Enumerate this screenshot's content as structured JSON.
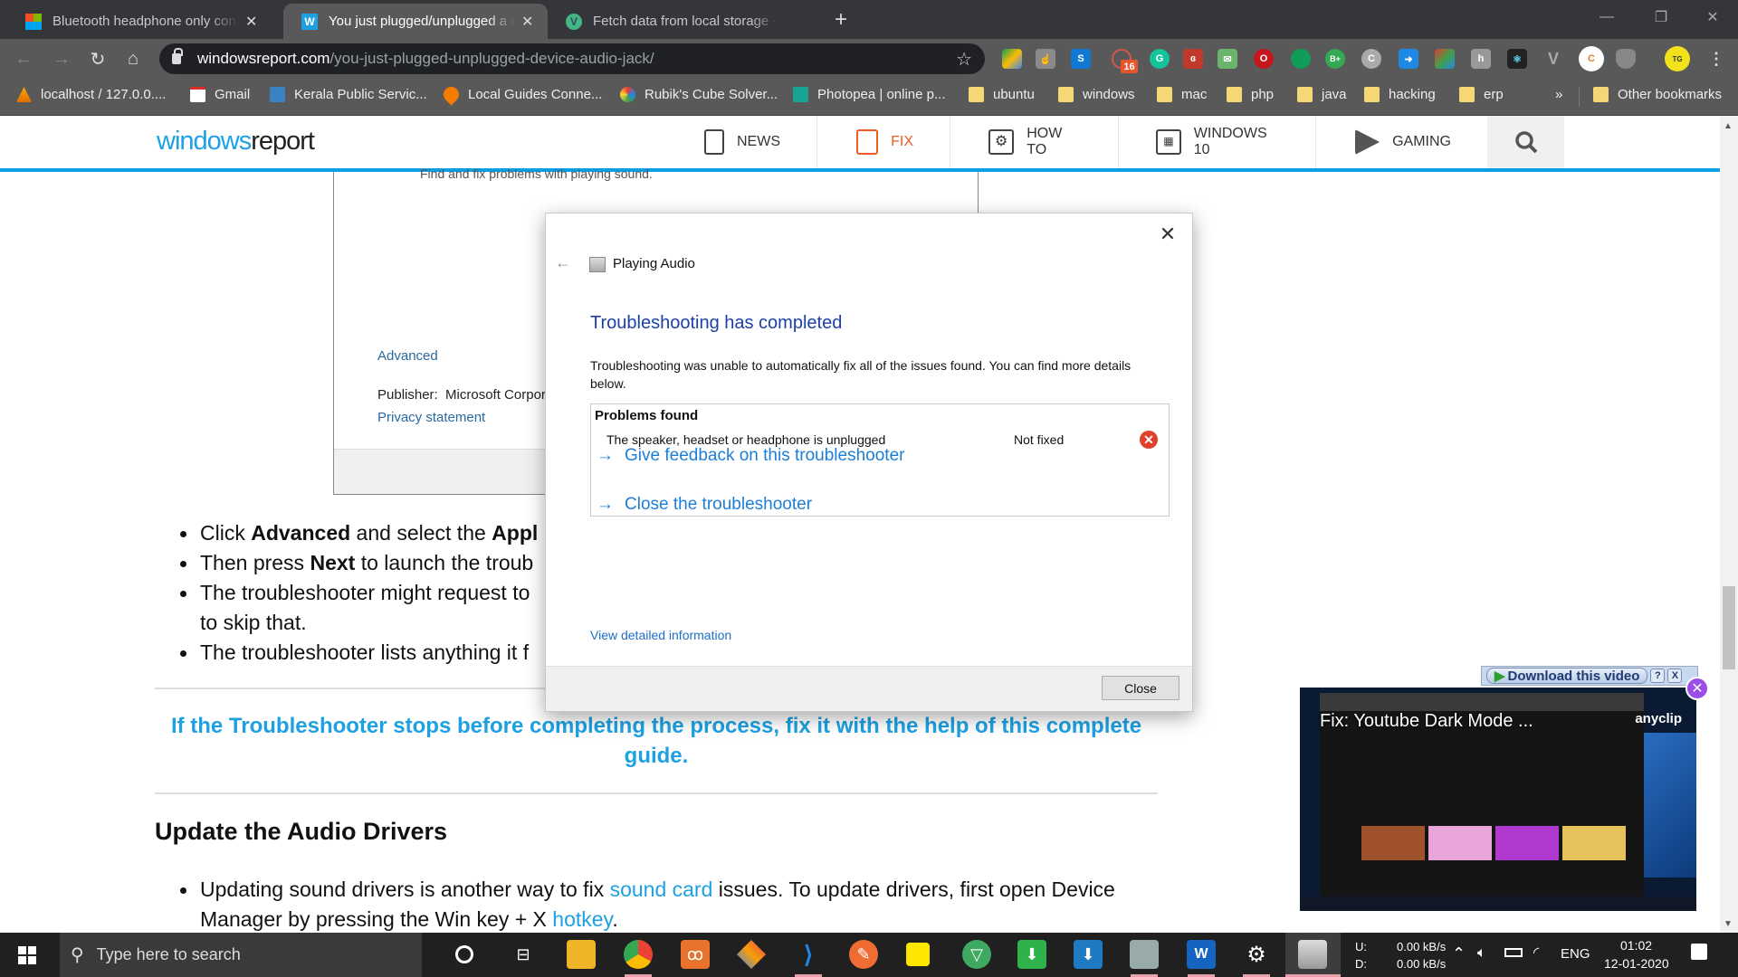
{
  "browser": {
    "tabs": [
      {
        "title": "Bluetooth headphone only conne",
        "favicon": "microsoft-icon",
        "active": false
      },
      {
        "title": "You just plugged/unplugged a de",
        "favicon": "windowsreport-w-icon",
        "active": true
      },
      {
        "title": "Fetch data from local storage - G",
        "favicon": "vuejs-icon",
        "active": false
      }
    ],
    "new_tab_label": "+",
    "url_host": "windowsreport.com",
    "url_path": "/you-just-plugged-unplugged-device-audio-jack/",
    "extensions": [
      "google-drive-icon",
      "touch-icon",
      "skype-icon",
      "badge-ext-icon",
      "grammarly-icon",
      "adobe-icon",
      "mail-check-icon",
      "opera-icon",
      "hangouts-icon",
      "bplus-icon",
      "grey-c-icon",
      "send-icon",
      "color-icon",
      "h-icon",
      "react-icon",
      "vue-icon",
      "bug-c-icon",
      "shield-icon",
      "profile-avatar",
      "more-icon"
    ],
    "extension_badge": "16",
    "bookmarks": [
      {
        "label": "localhost / 127.0.0....",
        "icon": "xampp-icon"
      },
      {
        "label": "Gmail",
        "icon": "gmail-icon"
      },
      {
        "label": "Kerala Public Servic...",
        "icon": "psc-icon"
      },
      {
        "label": "Local Guides Conne...",
        "icon": "local-guides-icon"
      },
      {
        "label": "Rubik's Cube Solver...",
        "icon": "rubik-icon"
      },
      {
        "label": "Photopea | online p...",
        "icon": "photopea-icon"
      },
      {
        "label": "ubuntu",
        "icon": "folder-icon"
      },
      {
        "label": "windows",
        "icon": "folder-icon"
      },
      {
        "label": "mac",
        "icon": "folder-icon"
      },
      {
        "label": "php",
        "icon": "folder-icon"
      },
      {
        "label": "java",
        "icon": "folder-icon"
      },
      {
        "label": "hacking",
        "icon": "folder-icon"
      },
      {
        "label": "erp",
        "icon": "folder-icon"
      }
    ],
    "bookmarks_overflow": "»",
    "other_bookmarks": "Other bookmarks"
  },
  "site": {
    "logo_part1": "windows",
    "logo_part2": "report",
    "nav": [
      {
        "label": "NEWS",
        "icon": "news-icon"
      },
      {
        "label": "FIX",
        "icon": "fix-icon"
      },
      {
        "label": "HOW TO",
        "icon": "howto-gear-icon"
      },
      {
        "label": "WINDOWS 10",
        "icon": "windows10-monitor-icon"
      },
      {
        "label": "GAMING",
        "icon": "gaming-controller-icon"
      }
    ],
    "accent": "#1da1e2"
  },
  "article": {
    "screenshot_caption_cut": "Find and fix problems with playing sound.",
    "screenshot_advanced": "Advanced",
    "screenshot_publisher_label": "Publisher:",
    "screenshot_publisher_value": "Microsoft Corpor",
    "screenshot_privacy": "Privacy statement",
    "bullets": [
      {
        "pre": "Click ",
        "b1": "Advanced",
        "mid": " and select the ",
        "b2": "Appl"
      },
      {
        "pre": "Then press ",
        "b1": "Next",
        "mid": " to launch the troub"
      },
      {
        "line1": "The troubleshooter might request to",
        "line2": "to skip that."
      },
      {
        "line1": "The troubleshooter lists anything it f"
      }
    ],
    "callout": "If the Troubleshooter stops before completing the process, fix it with the help of this complete guide.",
    "heading": "Update the Audio Drivers",
    "p_pre": "Updating sound drivers is another way to fix ",
    "p_link1": "sound card",
    "p_mid": " issues. To update drivers, first open Device",
    "p_line2_pre": "Manager by pressing the Win key + X ",
    "p_link2": "hotkey",
    "p_end": "."
  },
  "dialog": {
    "app_title": "Playing Audio",
    "heading": "Troubleshooting has completed",
    "message": "Troubleshooting was unable to automatically fix all of the issues found. You can find more details below.",
    "problems_header": "Problems found",
    "problems": [
      {
        "description": "The speaker, headset or headphone is unplugged",
        "status": "Not fixed",
        "status_icon": "error-icon"
      }
    ],
    "link_feedback": "Give feedback on this troubleshooter",
    "link_close": "Close the troubleshooter",
    "link_details": "View detailed information",
    "close_button": "Close",
    "heading_color": "#1c3fa8",
    "link_color": "#1c7ed6"
  },
  "video_ad": {
    "download_label": "Download this video",
    "help_label": "?",
    "dismiss_label": "X",
    "title": "Fix: Youtube Dark Mode ...",
    "brand": "anyclip"
  },
  "taskbar": {
    "search_placeholder": "Type here to search",
    "apps": [
      "cortana-icon",
      "task-view-icon",
      "file-explorer-icon",
      "chrome-icon",
      "xampp-icon",
      "git-icon",
      "vscode-icon",
      "postman-icon",
      "sticky-notes-icon",
      "vpn-icon",
      "downloader-icon",
      "install-icon",
      "monitor-icon",
      "waves-icon",
      "settings-icon",
      "troubleshooter-icon"
    ],
    "net_upload_label": "U:",
    "net_download_label": "D:",
    "net_upload": "0.00 kB/s",
    "net_download": "0.00 kB/s",
    "language": "ENG",
    "time": "01:02",
    "date": "12-01-2020"
  }
}
